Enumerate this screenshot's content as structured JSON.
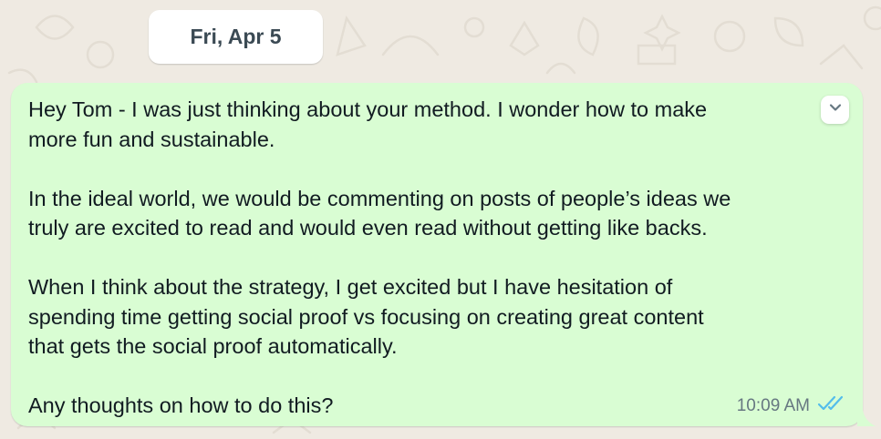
{
  "date_separator": "Fri, Apr 5",
  "message": {
    "text": "Hey Tom - I was just thinking about your method. I wonder how to make\nmore fun and sustainable.\n\nIn the ideal world, we would be commenting on posts of people’s ideas we\ntruly are excited to read and would even read without getting like backs.\n\nWhen I think about the strategy, I get excited but I have hesitation of\nspending time getting social proof vs focusing on creating great content\nthat gets the social proof automatically.\n\nAny thoughts on how to do this?",
    "time": "10:09 AM",
    "status_icon": "double-check-read-icon",
    "menu_icon": "chevron-down-icon"
  },
  "colors": {
    "wallpaper": "#efeae2",
    "bubble_outgoing": "#d9fdd3",
    "read_ticks": "#53bdeb"
  }
}
